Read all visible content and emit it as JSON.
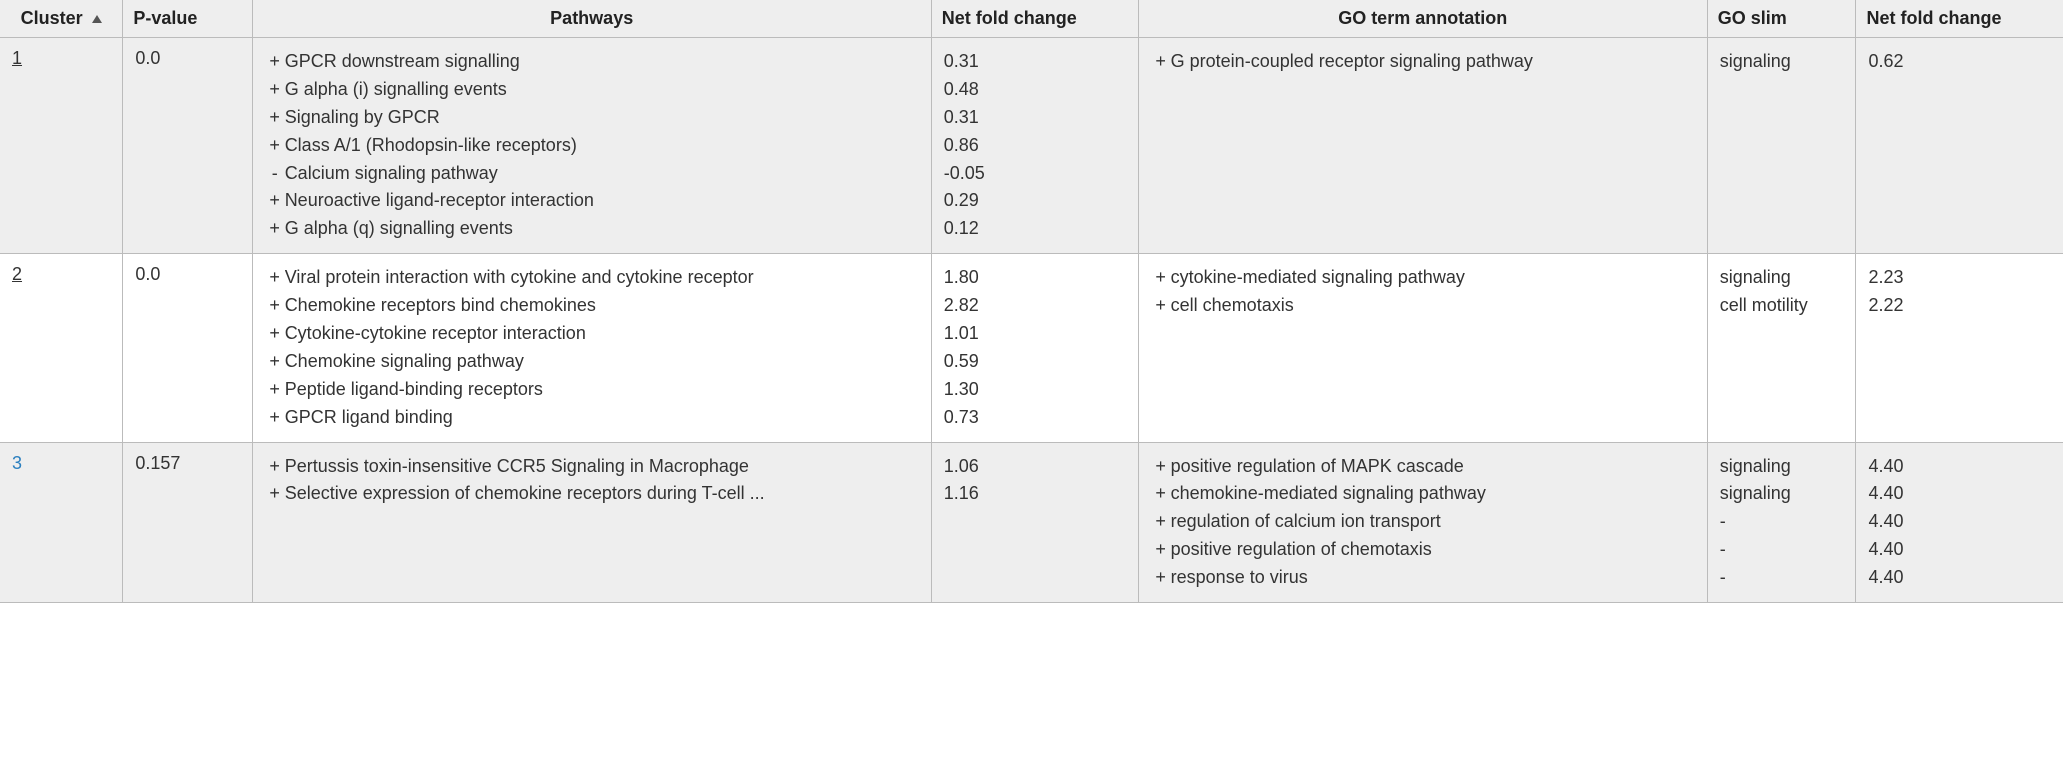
{
  "headers": {
    "cluster": "Cluster",
    "pvalue": "P-value",
    "pathways": "Pathways",
    "nfc1": "Net fold change",
    "go_term": "GO term annotation",
    "go_slim": "GO slim",
    "nfc2": "Net fold change"
  },
  "rows": [
    {
      "cluster": "1",
      "cluster_hover": false,
      "pvalue": "0.0",
      "alt": true,
      "pathways": [
        {
          "sign": "+",
          "text": "GPCR downstream signalling",
          "nfc": "0.31"
        },
        {
          "sign": "+",
          "text": "G alpha (i) signalling events",
          "nfc": "0.48"
        },
        {
          "sign": "+",
          "text": "Signaling by GPCR",
          "nfc": "0.31"
        },
        {
          "sign": "+",
          "text": "Class A/1 (Rhodopsin-like receptors)",
          "nfc": "0.86"
        },
        {
          "sign": "-",
          "text": "Calcium signaling pathway",
          "nfc": "-0.05"
        },
        {
          "sign": "+",
          "text": "Neuroactive ligand-receptor interaction",
          "nfc": "0.29"
        },
        {
          "sign": "+",
          "text": "G alpha (q) signalling events",
          "nfc": "0.12"
        }
      ],
      "go_terms": [
        {
          "sign": "+",
          "text": "G protein-coupled receptor signaling pathway",
          "slim": "signaling",
          "nfc": "0.62"
        }
      ]
    },
    {
      "cluster": "2",
      "cluster_hover": false,
      "pvalue": "0.0",
      "alt": false,
      "pathways": [
        {
          "sign": "+",
          "text": "Viral protein interaction with cytokine and cytokine receptor",
          "nfc": "1.80"
        },
        {
          "sign": "+",
          "text": "Chemokine receptors bind chemokines",
          "nfc": "2.82"
        },
        {
          "sign": "+",
          "text": "Cytokine-cytokine receptor interaction",
          "nfc": "1.01"
        },
        {
          "sign": "+",
          "text": "Chemokine signaling pathway",
          "nfc": "0.59"
        },
        {
          "sign": "+",
          "text": "Peptide ligand-binding receptors",
          "nfc": "1.30"
        },
        {
          "sign": "+",
          "text": "GPCR ligand binding",
          "nfc": "0.73"
        }
      ],
      "go_terms": [
        {
          "sign": "+",
          "text": "cytokine-mediated signaling pathway",
          "slim": "signaling",
          "nfc": "2.23"
        },
        {
          "sign": "+",
          "text": "cell chemotaxis",
          "slim": "cell motility",
          "nfc": "2.22"
        }
      ]
    },
    {
      "cluster": "3",
      "cluster_hover": true,
      "pvalue": "0.157",
      "alt": true,
      "pathways": [
        {
          "sign": "+",
          "text": "Pertussis toxin-insensitive CCR5 Signaling in Macrophage",
          "nfc": "1.06"
        },
        {
          "sign": "+",
          "text": "Selective expression of chemokine receptors during T-cell ...",
          "nfc": "1.16"
        }
      ],
      "go_terms": [
        {
          "sign": "+",
          "text": "positive regulation of MAPK cascade",
          "slim": "signaling",
          "nfc": "4.40"
        },
        {
          "sign": "+",
          "text": "chemokine-mediated signaling pathway",
          "slim": "signaling",
          "nfc": "4.40"
        },
        {
          "sign": "+",
          "text": "regulation of calcium ion transport",
          "slim": "-",
          "nfc": "4.40"
        },
        {
          "sign": "+",
          "text": "positive regulation of chemotaxis",
          "slim": "-",
          "nfc": "4.40"
        },
        {
          "sign": "+",
          "text": "response to virus",
          "slim": "-",
          "nfc": "4.40"
        }
      ]
    }
  ]
}
